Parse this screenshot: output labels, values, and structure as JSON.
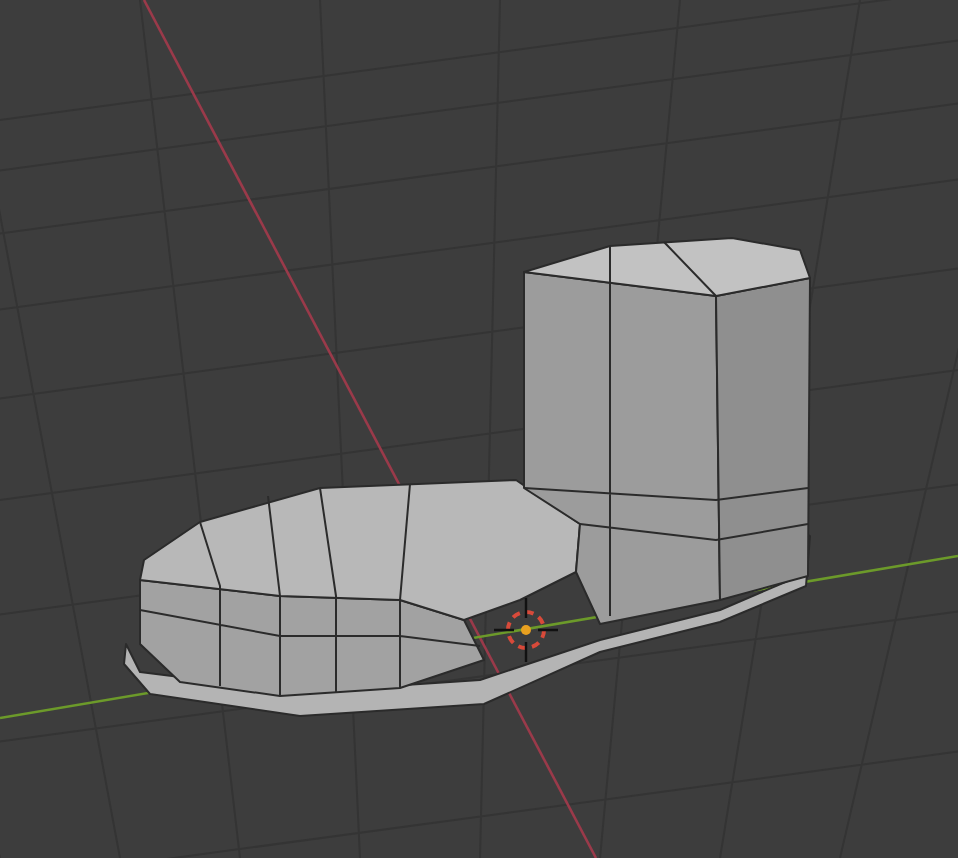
{
  "viewport": {
    "show_grid": true,
    "show_x_axis": true,
    "show_y_axis": true,
    "show_cursor": true
  }
}
